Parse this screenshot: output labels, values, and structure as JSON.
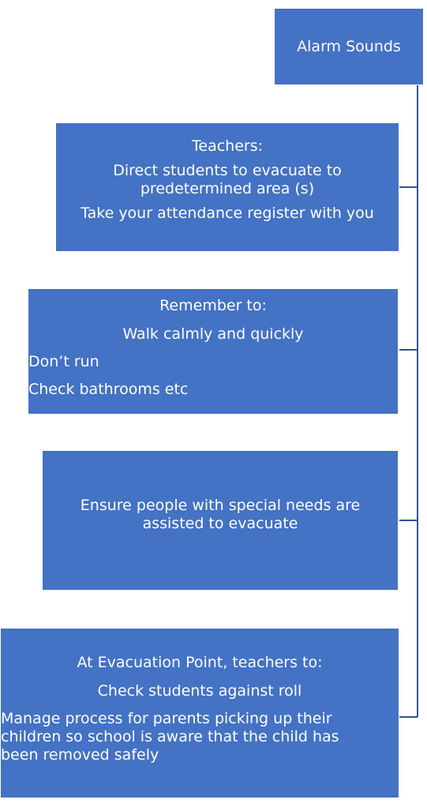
{
  "colors": {
    "box_fill": "#4472c4",
    "connector": "#2f5597",
    "text": "#ffffff"
  },
  "nodes": {
    "alarm": {
      "text": "Alarm Sounds"
    },
    "teachers": {
      "heading": "Teachers:",
      "line1": "Direct students to evacuate to",
      "line2": "predetermined area (s)",
      "line3": "Take your attendance register with you"
    },
    "remember": {
      "heading": "Remember to:",
      "line1": "Walk calmly  and quickly",
      "line2": "Don’t run",
      "line3": "Check bathrooms etc"
    },
    "special": {
      "line1": "Ensure people with special needs are",
      "line2": "assisted to evacuate"
    },
    "evacuation": {
      "heading": "At Evacuation Point, teachers to:",
      "line1": "Check students against roll",
      "line2": "Manage process for parents picking up their",
      "line3": "children so school is aware that the child has",
      "line4": "been removed safely"
    }
  }
}
